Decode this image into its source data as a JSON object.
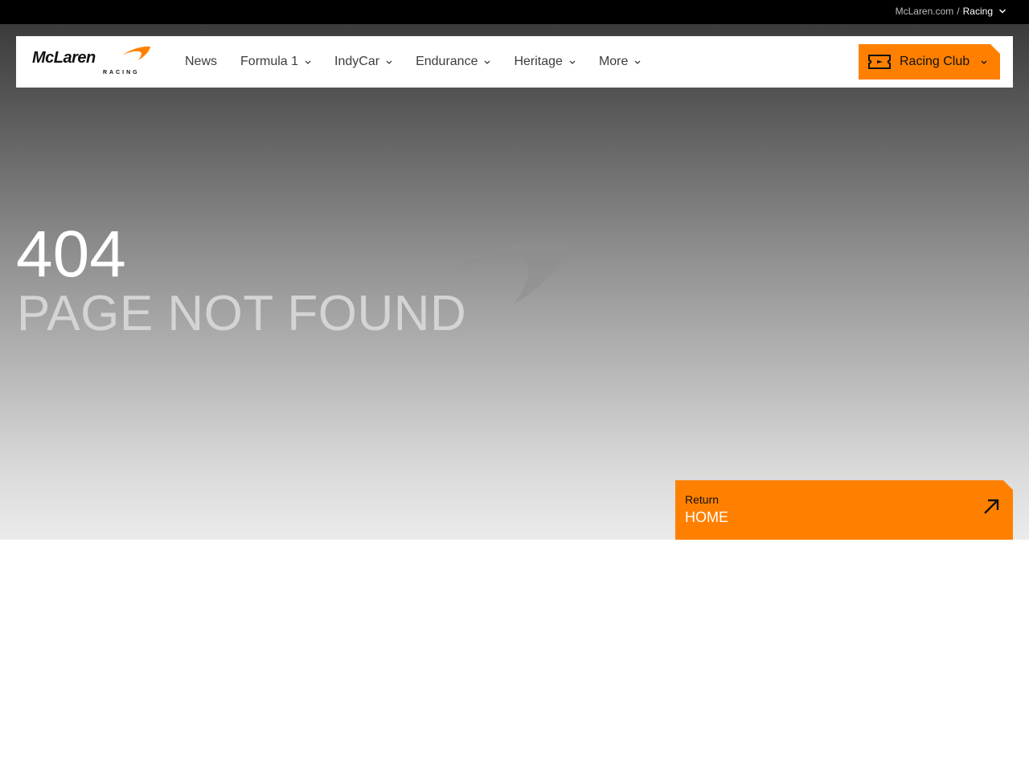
{
  "topbar": {
    "site": "McLaren.com",
    "separator": "/",
    "current": "Racing"
  },
  "logo": {
    "wordmark": "McLaren",
    "subtitle": "RACING"
  },
  "nav": {
    "items": [
      {
        "label": "News",
        "has_dropdown": false
      },
      {
        "label": "Formula 1",
        "has_dropdown": true
      },
      {
        "label": "IndyCar",
        "has_dropdown": true
      },
      {
        "label": "Endurance",
        "has_dropdown": true
      },
      {
        "label": "Heritage",
        "has_dropdown": true
      },
      {
        "label": "More",
        "has_dropdown": true
      }
    ],
    "club_button": "Racing Club"
  },
  "error": {
    "code": "404",
    "message": "PAGE NOT FOUND"
  },
  "home_button": {
    "small": "Return",
    "big": "HOME"
  },
  "colors": {
    "accent": "#ff8000",
    "topbar": "#000000",
    "nav_text": "#3d3d3d"
  }
}
